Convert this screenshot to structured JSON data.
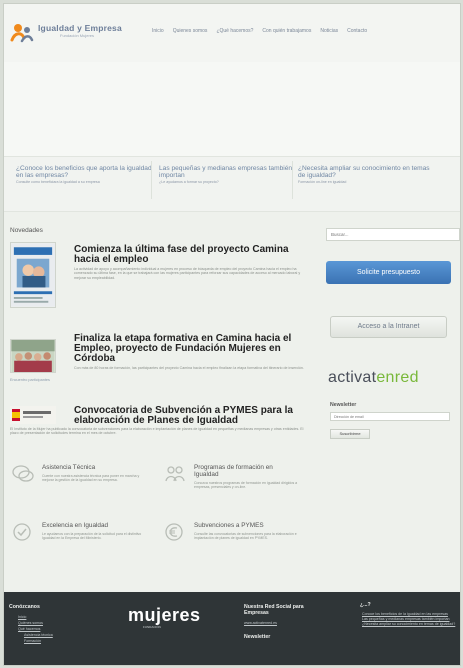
{
  "brand": {
    "name": "Igualdad y Empresa",
    "subtitle": "Fundación Mujeres",
    "colors": {
      "accent": "#6d7e99",
      "orange": "#f08a1c",
      "blue_button": "#4a86c8",
      "footer": "#2f3537"
    }
  },
  "nav": [
    "Inicio",
    "Quienes somos",
    "¿Qué hacemos?",
    "Con quién trabajamos",
    "Noticias",
    "Contacto"
  ],
  "teasers": [
    {
      "title": "¿Conoce los beneficios que aporta la igualdad en las empresas?",
      "link": "Consulte como beneficiara la igualdad a su empresa"
    },
    {
      "title": "Las pequeñas y medianas empresas también importan",
      "link": "¿Le ayudamos a formar su proyecto?"
    },
    {
      "title": "¿Necesita ampliar su conocimiento en temas de igualdad?",
      "link": "Formación on-line en igualdad"
    }
  ],
  "news": {
    "section_label": "Novedades",
    "articles": [
      {
        "title": "Comienza la última fase del proyecto Camina hacia el empleo",
        "summary": "La actividad de apoyo y acompañamiento individual a mujeres en proceso de búsqueda de empleo del proyecto Camina hacia el empleo ha comenzado su última fase, en la que se trabajará con las mujeres participantes para reforzar sus capacidades de acceso al mercado laboral y mejorar su empleabilidad."
      },
      {
        "title": "Finaliza la etapa formativa en Camina hacia el Empleo, proyecto de Fundación Mujeres en Córdoba",
        "summary": "Con más de 80 horas de formación, las participantes del proyecto Camina hacia el empleo finalizan la etapa formativa del itinerario de inserción.",
        "caption": "Encuentro participantes"
      },
      {
        "title": "Convocatoria de Subvención a PYMES para la elaboración de Planes de Igualdad",
        "summary": "El Instituto de la Mujer ha publicado la convocatoria de subvenciones para la elaboración e implantación de planes de igualdad en pequeñas y medianas empresas y otras entidades. El plazo de presentación de solicitudes termina en el mes de octubre."
      }
    ]
  },
  "features": [
    {
      "title": "Asistencia Técnica",
      "text": "Cuente con nuestra asistencia técnica para poner en marcha y mejorar la gestión de la igualdad en su empresa.",
      "icon": "speech-bubbles-icon"
    },
    {
      "title": "Programas de formación en Igualdad",
      "text": "Conozca nuestros programas de formación en igualdad dirigidos a empresas, presenciales y on-line.",
      "icon": "people-icon"
    },
    {
      "title": "Excelencia en Igualdad",
      "text": "Le ayudamos con la preparación de la solicitud para el distintivo Igualdad en la Empresa del Ministerio.",
      "icon": "badge-check-icon"
    },
    {
      "title": "Subvenciones a PYMES",
      "text": "Consulte las convocatorias de subvenciones para la elaboración e implantación de planes de igualdad en PYMES.",
      "icon": "euro-icon"
    }
  ],
  "sidebar": {
    "search_placeholder": "Buscar...",
    "budget_button": "Solicite presupuesto",
    "intranet_button": "Acceso a la Intranet",
    "activa_part1": "activat",
    "activa_part2": "enred",
    "newsletter_title": "Newsletter",
    "newsletter_placeholder": "Dirección de email",
    "subscribe_button": "Suscribirme"
  },
  "footer": {
    "col1_title": "Conózcanos",
    "col1_links": [
      "Inicio",
      "Quiénes somos",
      "Qué hacemos",
      "Asistencia técnica",
      "Formación"
    ],
    "logo": "mujeres",
    "logo_sub": "FUNDACIÓN",
    "col3_title": "Nuestra Red Social para Empresas",
    "col3_link": "www.activatenred.es",
    "col3_newsletter": "Newsletter",
    "col4_title": "¿...?",
    "col4_links": [
      "Conoce los beneficios de la igualdad en las empresas",
      "Las pequeñas y medianas empresas también importan",
      "¿Necesita ampliar su conocimiento en temas de igualdad?"
    ]
  }
}
